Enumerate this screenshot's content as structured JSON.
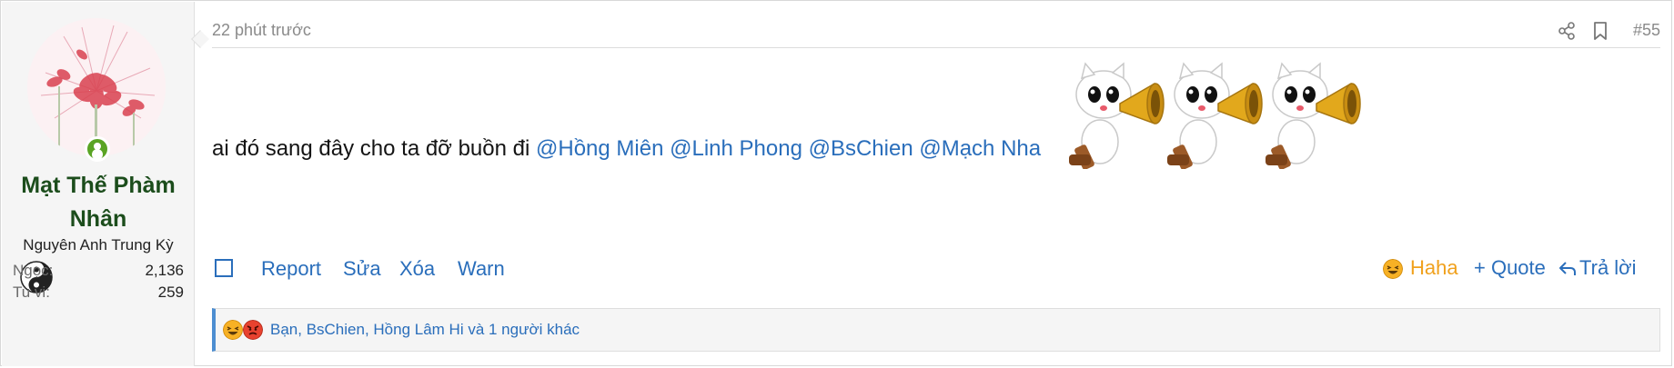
{
  "user": {
    "name_line1": "Mạt Thế Phàm",
    "name_line2": "Nhân",
    "title": "Nguyên Anh Trung Kỳ",
    "online": true,
    "stats": [
      {
        "label": "Ngọc:",
        "value": "2,136"
      },
      {
        "label": "Tu vi:",
        "value": "259"
      }
    ]
  },
  "post": {
    "time": "22 phút trước",
    "number": "#55",
    "text": "ai đó sang đây cho ta đỡ buồn đi ",
    "mentions": [
      "@Hồng Miên",
      "@Linh Phong",
      "@BsChien",
      "@Mạch Nha"
    ],
    "smilie_icon": "megaphone-cat-smilie",
    "smilie_count": 3
  },
  "actions": {
    "left": [
      "Report",
      "Sửa",
      "Xóa",
      "Warn"
    ],
    "haha": "Haha",
    "quote": "+ Quote",
    "reply": "Trả lời"
  },
  "reactions": {
    "icons": [
      "haha-emoji",
      "angry-emoji"
    ],
    "users": "Bạn, BsChien, Hồng Lâm Hi và 1 người khác"
  },
  "colors": {
    "link": "#2a6ebb",
    "username": "#1c4d1c",
    "haha": "#f0a11d",
    "online": "#5aa424",
    "reaction_bar_accent": "#4d8ed1"
  }
}
